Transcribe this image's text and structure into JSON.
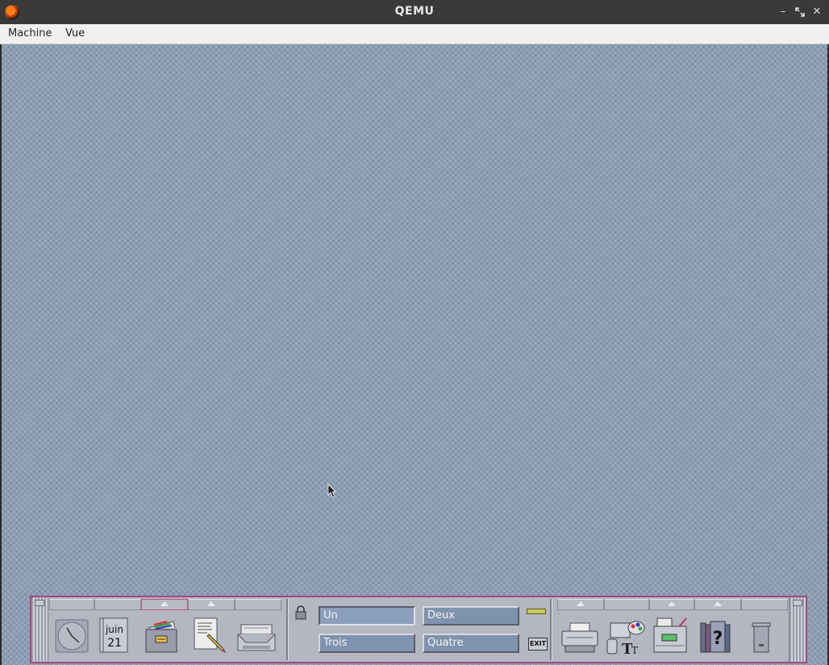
{
  "window": {
    "title": "QEMU"
  },
  "menu": {
    "machine": "Machine",
    "vue": "Vue"
  },
  "panel": {
    "calendar": {
      "month": "juin",
      "day": "21"
    },
    "workspaces": [
      "Un",
      "Deux",
      "Trois",
      "Quatre"
    ],
    "active_workspace": "Un",
    "exit_label": "EXIT"
  },
  "icons": {
    "clock": "clock-icon",
    "calendar": "calendar-icon",
    "file_manager": "file-manager-icon",
    "text_editor": "text-editor-icon",
    "mail": "mail-icon",
    "lock": "lock-icon",
    "printer": "printer-icon",
    "style_manager": "style-manager-icon",
    "application_manager": "application-manager-icon",
    "help": "help-icon",
    "trash": "trash-icon"
  }
}
